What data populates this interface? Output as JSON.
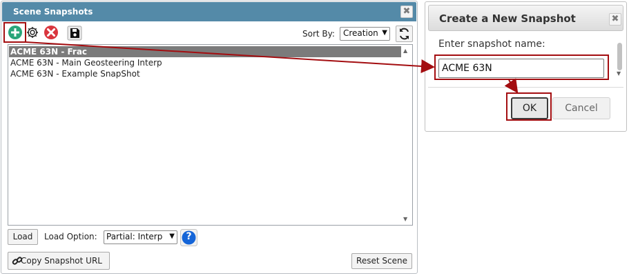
{
  "snapshots_panel": {
    "title": "Scene Snapshots",
    "close_glyph": "✖",
    "toolbar": {
      "add_icon": "plus-circle-icon",
      "settings_icon": "gear-icon",
      "delete_icon": "x-circle-icon",
      "save_icon": "floppy-disk-icon"
    },
    "sort_label": "Sort By:",
    "sort_value": "Creation",
    "refresh_icon": "refresh-icon",
    "items": [
      {
        "label": "ACME 63N - Frac",
        "selected": true
      },
      {
        "label": "ACME 63N - Main Geosteering Interp",
        "selected": false
      },
      {
        "label": "ACME 63N - Example SnapShot",
        "selected": false
      }
    ],
    "load_button": "Load",
    "load_option_label": "Load Option:",
    "load_option_value": "Partial: Interp",
    "help_glyph": "?",
    "copy_url_button": "Copy Snapshot URL",
    "reset_button": "Reset Scene"
  },
  "new_snapshot_dialog": {
    "title": "Create a New Snapshot",
    "close_glyph": "✖",
    "prompt": "Enter snapshot name:",
    "name_value": "ACME 63N",
    "ok_button": "OK",
    "cancel_button": "Cancel"
  },
  "colors": {
    "panel_title_bar": "#548aa8",
    "annotation": "#a30d10",
    "add_icon": "#2aa57a",
    "delete_icon": "#d9363e",
    "help_icon": "#1565d8"
  }
}
